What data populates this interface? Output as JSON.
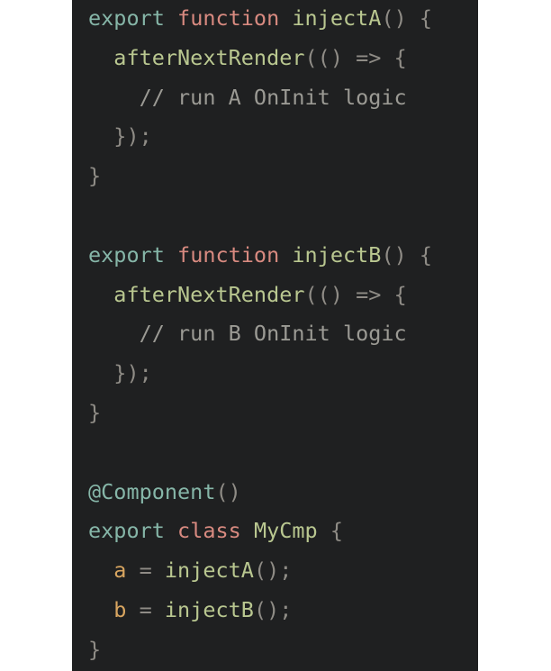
{
  "colors": {
    "background": "#1f2021",
    "keyword_export": "#86b6a8",
    "keyword_function": "#d88a80",
    "identifier": "#b9c790",
    "punctuation": "#8f8c86",
    "comment": "#9b9a94",
    "property": "#d8a560"
  },
  "code": {
    "lines": [
      [
        [
          "kw-export",
          "export "
        ],
        [
          "kw-function",
          "function "
        ],
        [
          "fn",
          "injectA"
        ],
        [
          "punc",
          "() {"
        ]
      ],
      [
        [
          "plain",
          "  "
        ],
        [
          "fn",
          "afterNextRender"
        ],
        [
          "punc",
          "(() => {"
        ]
      ],
      [
        [
          "plain",
          "    "
        ],
        [
          "comment",
          "// run A OnInit logic"
        ]
      ],
      [
        [
          "plain",
          "  "
        ],
        [
          "punc",
          "});"
        ]
      ],
      [
        [
          "punc",
          "}"
        ]
      ],
      [],
      [
        [
          "kw-export",
          "export "
        ],
        [
          "kw-function",
          "function "
        ],
        [
          "fn",
          "injectB"
        ],
        [
          "punc",
          "() {"
        ]
      ],
      [
        [
          "plain",
          "  "
        ],
        [
          "fn",
          "afterNextRender"
        ],
        [
          "punc",
          "(() => {"
        ]
      ],
      [
        [
          "plain",
          "    "
        ],
        [
          "comment",
          "// run B OnInit logic"
        ]
      ],
      [
        [
          "plain",
          "  "
        ],
        [
          "punc",
          "});"
        ]
      ],
      [
        [
          "punc",
          "}"
        ]
      ],
      [],
      [
        [
          "decor",
          "@Component"
        ],
        [
          "punc",
          "()"
        ]
      ],
      [
        [
          "kw-export",
          "export "
        ],
        [
          "kw-function",
          "class "
        ],
        [
          "class",
          "MyCmp "
        ],
        [
          "punc",
          "{"
        ]
      ],
      [
        [
          "plain",
          "  "
        ],
        [
          "prop",
          "a"
        ],
        [
          "punc",
          " = "
        ],
        [
          "fn",
          "injectA"
        ],
        [
          "punc",
          "();"
        ]
      ],
      [
        [
          "plain",
          "  "
        ],
        [
          "prop",
          "b"
        ],
        [
          "punc",
          " = "
        ],
        [
          "fn",
          "injectB"
        ],
        [
          "punc",
          "();"
        ]
      ],
      [
        [
          "punc",
          "}"
        ]
      ]
    ]
  }
}
